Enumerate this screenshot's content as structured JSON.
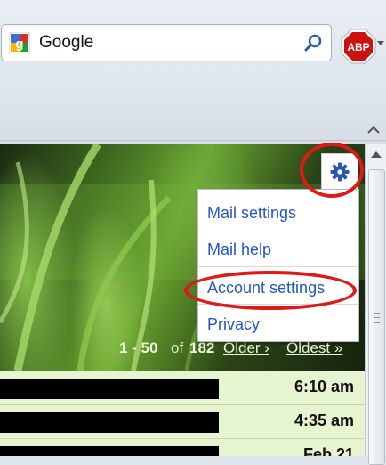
{
  "browser": {
    "search_engine": "Google",
    "addon": {
      "label": "ABP",
      "color": "#cc1111"
    }
  },
  "gmail": {
    "menu": {
      "items": [
        {
          "label": "Mail settings"
        },
        {
          "label": "Mail help"
        },
        {
          "label": "Account settings"
        },
        {
          "label": "Privacy"
        }
      ]
    },
    "pager": {
      "range": "1 - 50",
      "of_label": "of",
      "total": "182",
      "older": "Older ›",
      "oldest": "Oldest »"
    },
    "messages": [
      {
        "time": "6:10 am"
      },
      {
        "time": "4:35 am"
      },
      {
        "time": "Feb 21"
      }
    ]
  },
  "colors": {
    "link": "#2255cc",
    "annotation": "#e01818",
    "row_bg": "#e6f4cf"
  }
}
